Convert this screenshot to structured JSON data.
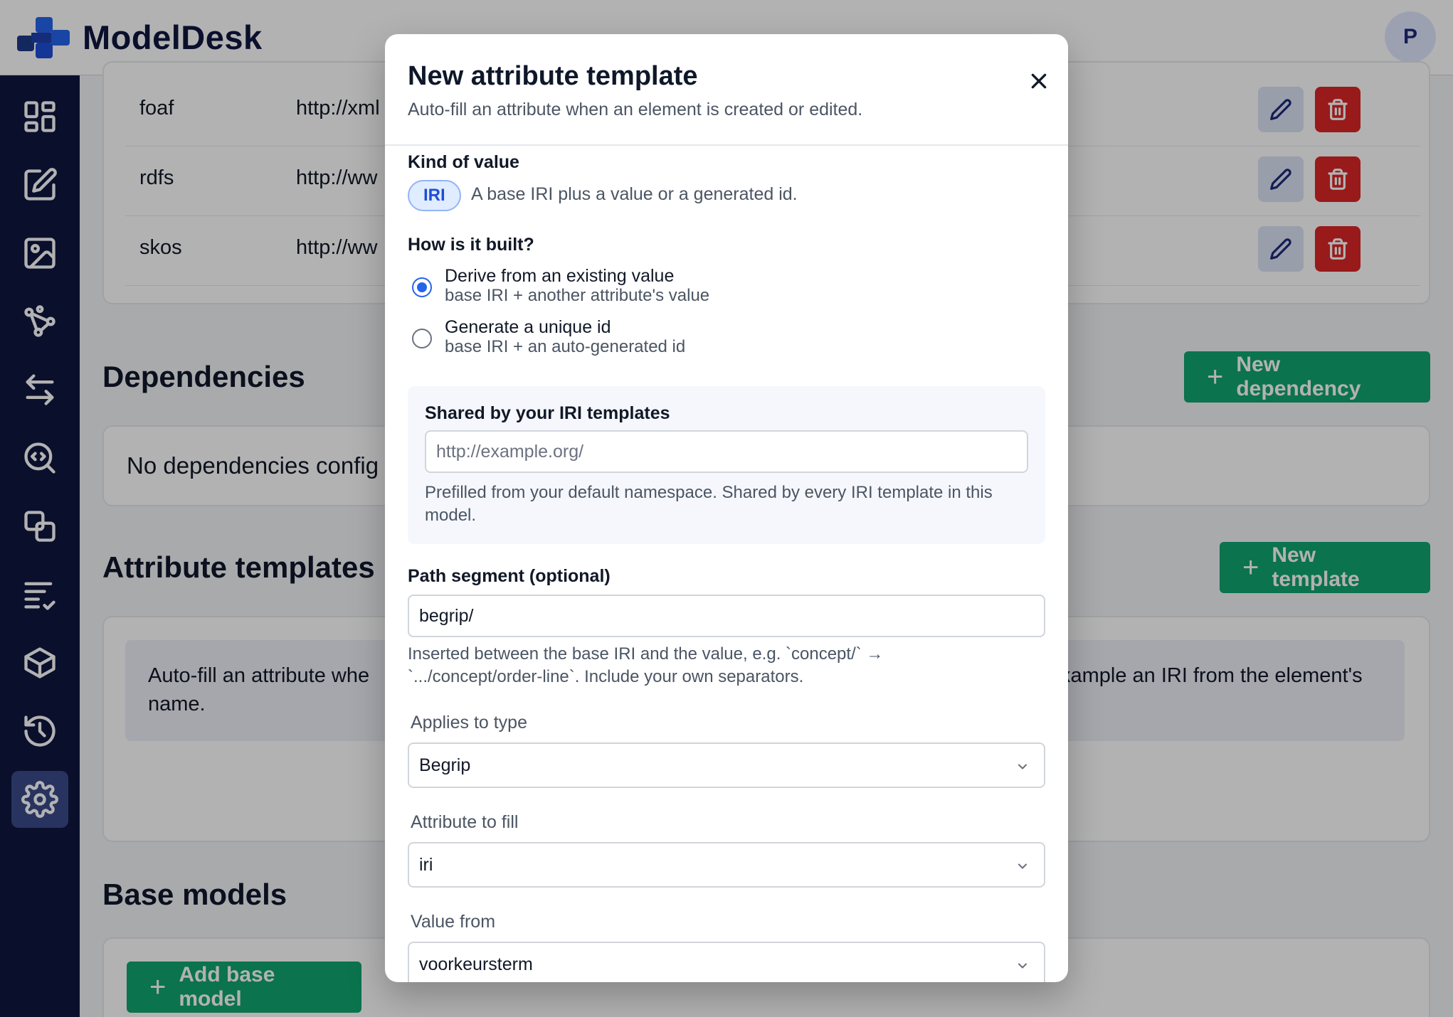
{
  "app": {
    "name": "ModelDesk",
    "avatar_initial": "P"
  },
  "sidebar": {
    "items": [
      {
        "icon": "dashboard-icon"
      },
      {
        "icon": "edit-icon"
      },
      {
        "icon": "image-icon"
      },
      {
        "icon": "graph-icon"
      },
      {
        "icon": "transfer-icon"
      },
      {
        "icon": "search-code-icon"
      },
      {
        "icon": "shapes-icon"
      },
      {
        "icon": "checklist-icon"
      },
      {
        "icon": "package-icon"
      },
      {
        "icon": "history-icon"
      },
      {
        "icon": "settings-icon",
        "active": true
      }
    ]
  },
  "namespaces": {
    "rows": [
      {
        "prefix": "foaf",
        "uri": "http://xml"
      },
      {
        "prefix": "rdfs",
        "uri": "http://ww"
      },
      {
        "prefix": "skos",
        "uri": "http://ww"
      }
    ]
  },
  "dependencies": {
    "title": "Dependencies",
    "new_button": "New dependency",
    "empty_text": "No dependencies config"
  },
  "attribute_templates": {
    "title": "Attribute templates",
    "new_button": "New template",
    "info_left": "Auto-fill an attribute whe",
    "info_left_line2": "name.",
    "info_right": "xample an IRI from the element's"
  },
  "base_models": {
    "title": "Base models",
    "add_button": "Add base model"
  },
  "modal": {
    "title": "New attribute template",
    "subtitle": "Auto-fill an attribute when an element is created or edited.",
    "kind_label": "Kind of value",
    "kind_pill": "IRI",
    "kind_desc": "A base IRI plus a value or a generated id.",
    "build_label": "How is it built?",
    "options": [
      {
        "title": "Derive from an existing value",
        "desc": "base IRI + another attribute's value",
        "checked": true
      },
      {
        "title": "Generate a unique id",
        "desc": "base IRI + an auto-generated id",
        "checked": false
      }
    ],
    "shared_label": "Shared by your IRI templates",
    "shared_placeholder": "http://example.org/",
    "shared_help_1": "Prefilled from your default namespace. Shared by every IRI template in this",
    "shared_help_2": "model.",
    "path_label": "Path segment (optional)",
    "path_value": "begrip/",
    "path_help_1": "Inserted between the base IRI and the value, e.g. `concept/` →",
    "path_help_2": "`.../concept/order-line`. Include your own separators.",
    "applies_label": "Applies to type",
    "applies_value": "Begrip",
    "attribute_label": "Attribute to fill",
    "attribute_value": "iri",
    "value_from_label": "Value from",
    "value_from_value": "voorkeursterm"
  }
}
